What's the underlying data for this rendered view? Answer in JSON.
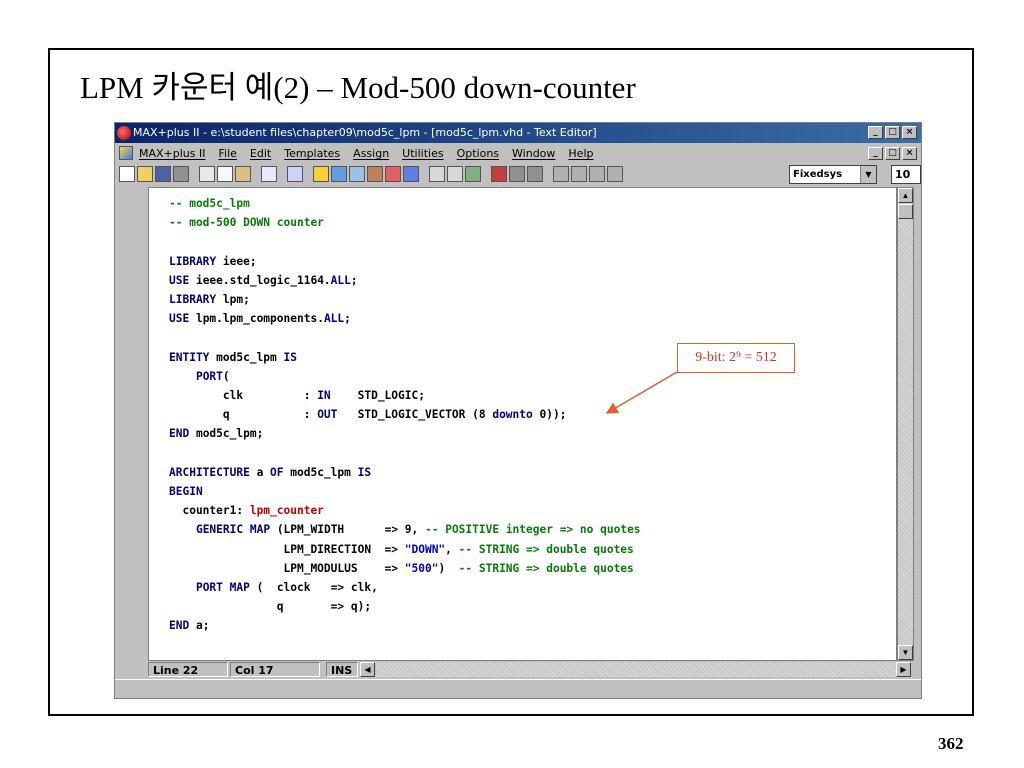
{
  "slide": {
    "title": "LPM 카운터 예(2) – Mod-500 down-counter",
    "page_number": "362"
  },
  "window": {
    "title": "MAX+plus II - e:\\student files\\chapter09\\mod5c_lpm - [mod5c_lpm.vhd - Text Editor]",
    "buttons": {
      "minimize": "_",
      "maximize": "□",
      "close": "×",
      "restore": "🗗"
    }
  },
  "menu": {
    "items": [
      "MAX+plus II",
      "File",
      "Edit",
      "Templates",
      "Assign",
      "Utilities",
      "Options",
      "Window",
      "Help"
    ]
  },
  "toolbar": {
    "font_name": "Fixedsys",
    "font_size": "10"
  },
  "code": {
    "lines": [
      "-- mod5c_lpm",
      "-- mod-500 DOWN counter",
      "",
      "LIBRARY ieee;",
      "USE ieee.std_logic_1164.ALL;",
      "LIBRARY lpm;",
      "USE lpm.lpm_components.ALL;",
      "",
      "ENTITY mod5c_lpm IS",
      "    PORT(",
      "        clk         : IN    STD_LOGIC;",
      "        q           : OUT   STD_LOGIC_VECTOR (8 downto 0));",
      "END mod5c_lpm;",
      "",
      "ARCHITECTURE a OF mod5c_lpm IS",
      "BEGIN",
      "  counter1: lpm_counter",
      "    GENERIC MAP (LPM_WIDTH      => 9, -- POSITIVE integer => no quotes",
      "                 LPM_DIRECTION  => \"DOWN\", -- STRING => double quotes",
      "                 LPM_MODULUS    => \"500\")  -- STRING => double quotes",
      "    PORT MAP (  clock   => clk,",
      "                q       => q);",
      "END a;"
    ]
  },
  "status": {
    "line": "Line  22",
    "col": "Col  17",
    "mode": "INS"
  },
  "annotation": {
    "text": "9-bit: 2⁹ = 512",
    "color": "#c0392b"
  },
  "colors": {
    "keyword": "#00007a",
    "comment": "#087a08",
    "string": "#0000cc",
    "component": "#c00000",
    "titlebar": "#0a246a"
  }
}
